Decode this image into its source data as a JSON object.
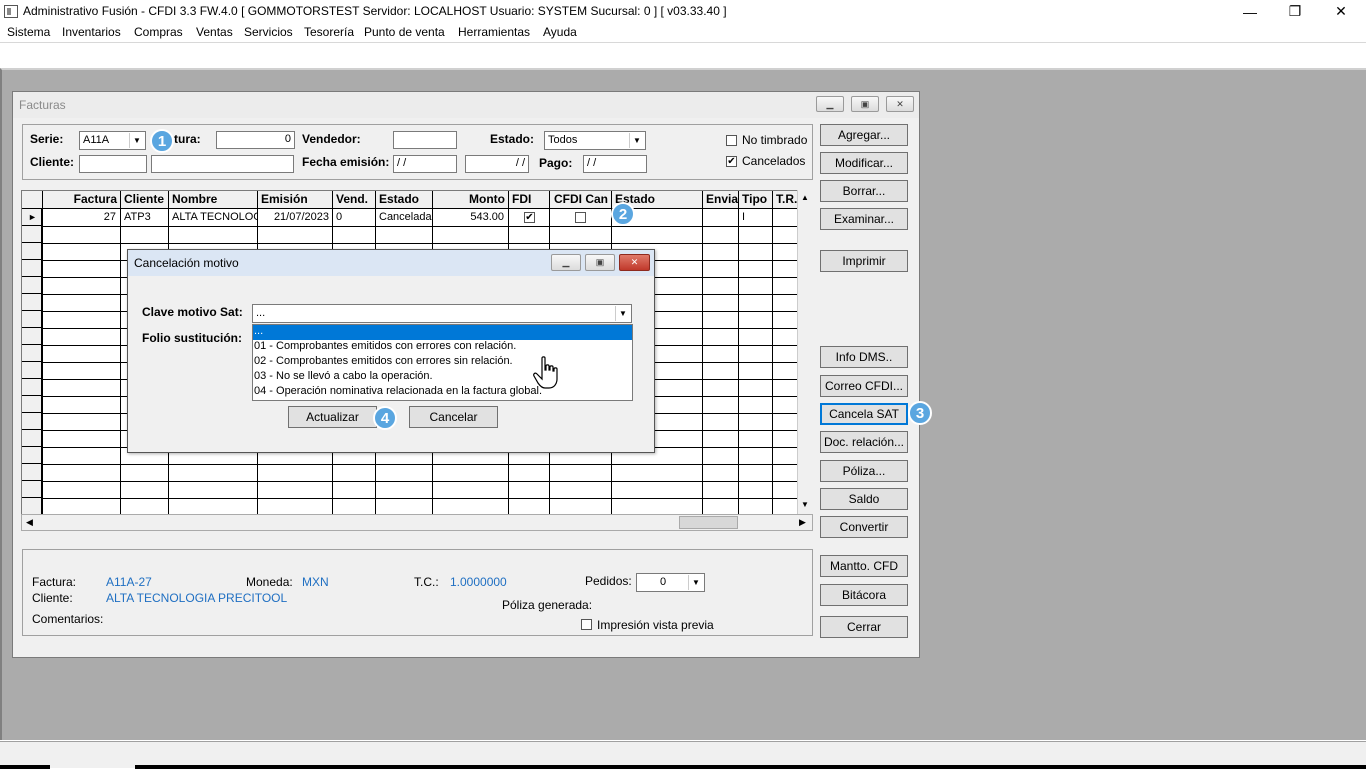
{
  "window": {
    "title": "Administrativo Fusión - CFDI 3.3 FW.4.0 [ GOMMOTORSTEST  Servidor: LOCALHOST  Usuario: SYSTEM    Sucursal: 0 ] [ v03.33.40 ]",
    "minimize": "—",
    "maximize": "❐",
    "close": "✕"
  },
  "menu": [
    "Sistema",
    "Inventarios",
    "Compras",
    "Ventas",
    "Servicios",
    "Tesorería",
    "Punto de venta",
    "Herramientas",
    "Ayuda"
  ],
  "facturas": {
    "title": "Facturas",
    "filters": {
      "serie_label": "Serie:",
      "serie_value": "A11A",
      "factura_label": "tura:",
      "factura_value": "0",
      "vendedor_label": "Vendedor:",
      "vendedor_value": "",
      "estado_label": "Estado:",
      "estado_value": "Todos",
      "cliente_label": "Cliente:",
      "fecha_label": "Fecha emisión:",
      "fecha_from": "/ /",
      "fecha_to": "/ /",
      "pago_label": "Pago:",
      "pago_value": "/ /",
      "no_timbrado": "No timbrado",
      "cancelados": "Cancelados",
      "no_timbrado_checked": false,
      "cancelados_checked": true
    },
    "grid": {
      "headers": [
        "Factura",
        "Cliente",
        "Nombre",
        "Emisión",
        "Vend.",
        "Estado",
        "Monto",
        "FDI",
        "CFDI Can",
        "Estado",
        "Envia",
        "Tipo",
        "T.R."
      ],
      "row": {
        "marker": "►",
        "factura": "27",
        "cliente": "ATP3",
        "nombre": "ALTA TECNOLOG",
        "emision": "21/07/2023",
        "vend": "0",
        "estado": "Cancelada",
        "monto": "543.00",
        "fdi_check": "✔",
        "tipo": "I"
      }
    },
    "buttons": [
      "Agregar...",
      "Modificar...",
      "Borrar...",
      "Examinar...",
      "Imprimir",
      "Info DMS..",
      "Correo CFDI...",
      "Cancela SAT",
      "Doc. relación...",
      "Póliza...",
      "Saldo",
      "Convertir",
      "Mantto. CFD",
      "Bitácora",
      "Cerrar"
    ],
    "info": {
      "factura_label": "Factura:",
      "factura_value": "A11A-27",
      "moneda_label": "Moneda:",
      "moneda_value": "MXN",
      "tc_label": "T.C.:",
      "tc_value": "1.0000000",
      "pedidos_label": "Pedidos:",
      "pedidos_value": "0",
      "cliente_label": "Cliente:",
      "cliente_value": "ALTA TECNOLOGIA PRECITOOL",
      "poliza_label": "Póliza generada:",
      "comentarios_label": "Comentarios:",
      "impresion_label": "Impresión vista previa"
    }
  },
  "dialog": {
    "title": "Cancelación motivo",
    "clave_label": "Clave motivo Sat:",
    "clave_value": "...",
    "folio_label": "Folio sustitución:",
    "options": [
      "...",
      "01 - Comprobantes emitidos con errores con relación.",
      "02 - Comprobantes emitidos con errores sin relación.",
      "03 - No se llevó a cabo la operación.",
      "04 - Operación nominativa relacionada en la factura global."
    ],
    "actualizar": "Actualizar",
    "cancelar": "Cancelar"
  },
  "badges": [
    "1",
    "2",
    "3",
    "4"
  ],
  "colors": {
    "accent": "#0078d7",
    "badge": "#5aa6e0",
    "link": "#1f6fc2"
  }
}
